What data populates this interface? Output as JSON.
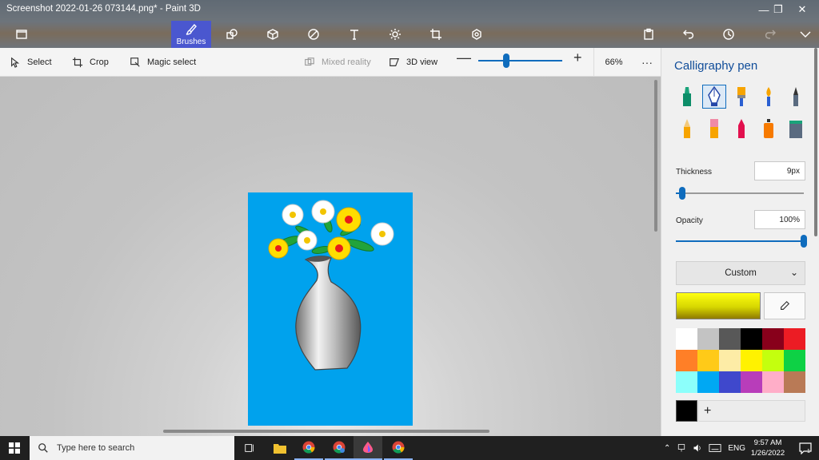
{
  "window": {
    "title": "Screenshot 2022-01-26 073144.png* - Paint 3D",
    "minimize_glyph": "—",
    "maximize_glyph": "❐",
    "close_glyph": "✕"
  },
  "ribbon": {
    "active_tab_label": "Brushes",
    "icons": [
      "menu-icon",
      "brushes-icon",
      "2d-shapes-icon",
      "3d-shapes-icon",
      "stickers-icon",
      "text-icon",
      "effects-icon",
      "canvas-icon",
      "3d-library-icon",
      "paste-icon",
      "undo-icon",
      "history-icon",
      "redo-icon",
      "expand-icon"
    ]
  },
  "toolbar": {
    "select": "Select",
    "crop": "Crop",
    "magic_select": "Magic select",
    "mixed_reality": "Mixed reality",
    "view_3d": "3D view",
    "zoom_minus": "—",
    "zoom_plus": "+",
    "zoom_value": "66%",
    "zoom_level": 0.33,
    "more": "···"
  },
  "panel": {
    "title": "Calligraphy pen",
    "brushes": [
      "marker",
      "calligraphy-pen",
      "oil-brush",
      "watercolor",
      "pixel-pen",
      "pencil",
      "eraser",
      "crayon",
      "spray-can",
      "fill"
    ],
    "selected_brush": "calligraphy-pen",
    "thickness_label": "Thickness",
    "thickness_value": "9px",
    "thickness_level": 0.05,
    "opacity_label": "Opacity",
    "opacity_value": "100%",
    "opacity_level": 1.0,
    "color_mode": "Custom",
    "add_color": "+",
    "palette": [
      "#ffffff",
      "#c3c3c3",
      "#585858",
      "#000000",
      "#88001b",
      "#ec1c24",
      "#ff7f27",
      "#ffca18",
      "#fdeca6",
      "#fff200",
      "#c4ff0e",
      "#0ed145",
      "#8cfffb",
      "#00a8f3",
      "#3f48cc",
      "#b83dba",
      "#ffaec8",
      "#b97a56"
    ],
    "accent": "#0f6cbd"
  },
  "taskbar": {
    "search_placeholder": "Type here to search",
    "apps": [
      "task-view-icon",
      "file-explorer-icon",
      "chrome-icon",
      "chrome-profile-icon",
      "paint-3d-icon",
      "chrome-icon"
    ],
    "language": "ENG",
    "time": "9:57 AM",
    "date": "1/26/2022",
    "notifications": "1"
  }
}
